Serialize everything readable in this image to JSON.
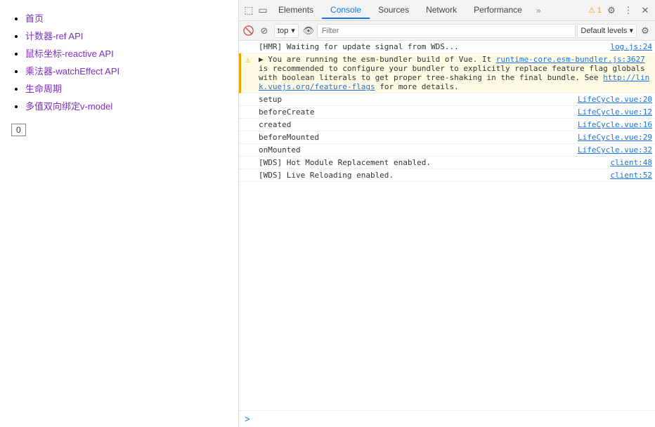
{
  "leftPanel": {
    "links": [
      {
        "label": "首页",
        "href": "#"
      },
      {
        "label": "计数器-ref API",
        "href": "#"
      },
      {
        "label": "鼠标坐标-reactive API",
        "href": "#"
      },
      {
        "label": "乘法器-watchEffect API",
        "href": "#"
      },
      {
        "label": "生命周期",
        "href": "#"
      },
      {
        "label": "多值双向绑定v-model",
        "href": "#"
      }
    ],
    "counterBadge": "0"
  },
  "devtools": {
    "topIcons": [
      {
        "name": "inspect-icon",
        "symbol": "⬚"
      },
      {
        "name": "device-icon",
        "symbol": "▭"
      }
    ],
    "tabs": [
      {
        "label": "Elements",
        "active": false
      },
      {
        "label": "Console",
        "active": true
      },
      {
        "label": "Sources",
        "active": false
      },
      {
        "label": "Network",
        "active": false
      },
      {
        "label": "Performance",
        "active": false
      }
    ],
    "tabMore": "»",
    "warningBadge": "⚠ 1",
    "consoleToolbar": {
      "clearIcon": "🚫",
      "filterPlaceholder": "Filter",
      "contextLabel": "top",
      "contextArrow": "▾",
      "eyeIcon": "👁",
      "levelsLabel": "Default levels ▾",
      "settingsIcon": "⚙"
    },
    "logs": [
      {
        "type": "info",
        "text": "[HMR] Waiting for update signal from WDS...",
        "source": "log.js:24"
      },
      {
        "type": "warning",
        "hasWarningIcon": true,
        "textParts": [
          {
            "type": "text",
            "content": "▶ You are running the esm-bundler build of Vue. It "
          },
          {
            "type": "link",
            "content": "runtime-core.esm-bundler.js:3627"
          },
          {
            "type": "text",
            "content": " is recommended to configure your bundler to explicitly replace feature flag globals with boolean literals to get proper tree-shaking in the final bundle. See "
          },
          {
            "type": "link",
            "content": "http://link.vuejs.org/feature-flags"
          },
          {
            "type": "text",
            "content": " for more details."
          }
        ],
        "source": ""
      },
      {
        "type": "info",
        "text": "setup",
        "source": "LifeCycle.vue:20"
      },
      {
        "type": "info",
        "text": "beforeCreate",
        "source": "LifeCycle.vue:12"
      },
      {
        "type": "info",
        "text": "created",
        "source": "LifeCycle.vue:16"
      },
      {
        "type": "info",
        "text": "beforeMounted",
        "source": "LifeCycle.vue:29"
      },
      {
        "type": "info",
        "text": "onMounted",
        "source": "LifeCycle.vue:32"
      },
      {
        "type": "info",
        "text": "[WDS] Hot Module Replacement enabled.",
        "source": "client:48"
      },
      {
        "type": "info",
        "text": "[WDS] Live Reloading enabled.",
        "source": "client:52"
      }
    ],
    "promptArrow": ">"
  }
}
